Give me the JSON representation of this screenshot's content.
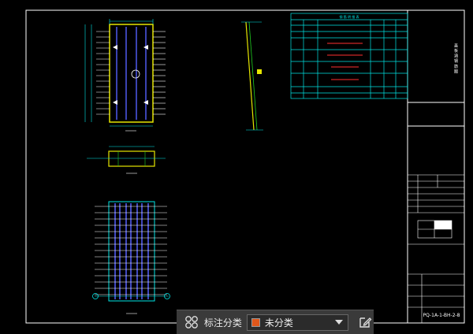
{
  "toolbar": {
    "annotation_label": "标注分类",
    "category_value": "未分类",
    "category_color": "#e0571b",
    "grid_icon": "grid-icon",
    "dropdown_icon": "chevron-down-icon",
    "edit_icon": "edit-icon"
  },
  "drawing": {
    "frame_color": "#ffffff",
    "line_cyan": "#00e5e5",
    "line_yellow": "#e6e600",
    "line_blue": "#5560ff",
    "line_green": "#20d020",
    "table_title": "钢 筋 明 细 表",
    "sheet_number": "PQ-1A-1-BH-2-8",
    "vertical_title": "盖 板 涵 钢 筋 图"
  }
}
